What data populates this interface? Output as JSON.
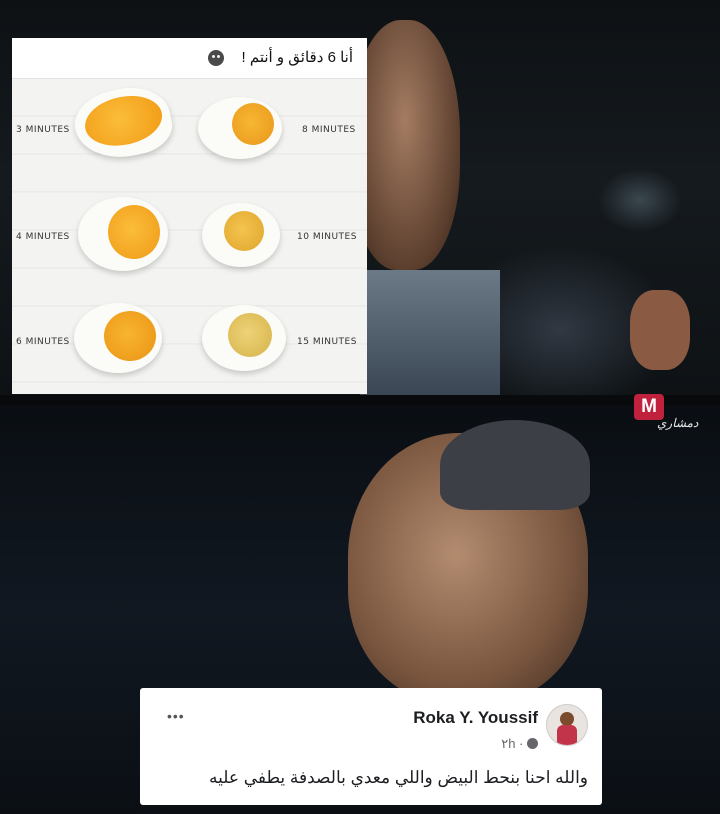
{
  "card": {
    "caption": "أنا 6 دقائق و أنتم !",
    "times": [
      {
        "label": "3 MINUTES"
      },
      {
        "label": "8 MINUTES"
      },
      {
        "label": "4 MINUTES"
      },
      {
        "label": "10 MINUTES"
      },
      {
        "label": "6 MINUTES"
      },
      {
        "label": "15 MINUTES"
      }
    ]
  },
  "logo": {
    "letter": "M",
    "text": "دمشاري"
  },
  "comment": {
    "author": "Roka Y. Youssif",
    "time": "٢h",
    "text": "والله احنا بنحط البيض واللي معدي بالصدفة يطفي عليه",
    "more": "•••"
  },
  "colors": {
    "runny_yolk": "#f2a81c",
    "set_yolk": "#e8c85a",
    "comment_bg": "#ffffff"
  }
}
